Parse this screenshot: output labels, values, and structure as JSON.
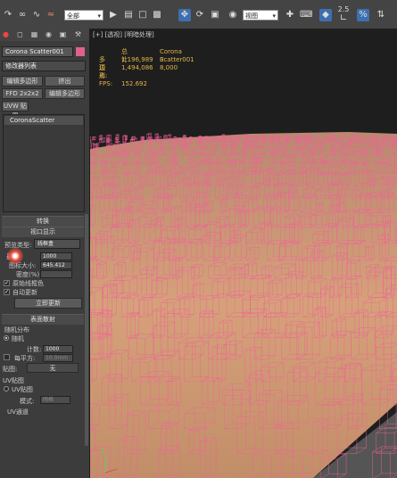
{
  "toolbar": {
    "filter_value": "全部",
    "view_value": "视图",
    "snap_label": "2.5",
    "icons": [
      "arrow-icon",
      "link-icon",
      "unlink-icon",
      "bind-space-warp-icon",
      "select-object-icon",
      "select-by-name-icon",
      "rect-region-icon",
      "window-crossing-icon",
      "move-icon",
      "rotate-icon",
      "scale-icon",
      "pivot-icon",
      "select-manipulate-icon",
      "snap-icon",
      "angle-snap-icon",
      "percent-snap-icon"
    ]
  },
  "command_panel": {
    "tabs": [
      "create-icon",
      "modify-icon",
      "hierarchy-icon",
      "motion-icon",
      "display-icon",
      "utilities-icon"
    ],
    "object_name": "Corona Scatter001",
    "modifier_list": "修改器列表",
    "btn_edit_poly": "编辑多边形",
    "btn_extrude": "挤出",
    "btn_ffd": "FFD 2x2x2",
    "btn_edit_patch": "编辑多边形",
    "btn_uvw": "UVW 贴图",
    "stack_item": "CoronaScatter"
  },
  "rollouts": {
    "transform_header": "转换",
    "viewport_header": "视口显示",
    "preview_type_label": "预览类型:",
    "preview_type_value": "线框盒",
    "max_label": "最大",
    "max_value": "1000",
    "instances_label": "图标大小:",
    "instances_value": "645.412",
    "density_label": "密度(%):",
    "density_value": "",
    "orig_color_label": "原始线框色",
    "auto_update_label": "自动更新",
    "update_button": "立即更新",
    "surface_header": "表面散射",
    "random_dist_label": "随机分布",
    "random_radio": "随机",
    "count_label": "计数:",
    "count_value": "1000",
    "per_area_label": "每平方:",
    "per_area_value": "10.0mm",
    "map_label": "贴图:",
    "map_value": "无",
    "uv_header": "UV贴图",
    "uv_radio": "UV贴图",
    "mode_label": "模式:",
    "mode_value": "网格",
    "uv_channel_label": "UV通道"
  },
  "viewport": {
    "label": "[+] [透视] [明暗处理]",
    "stats": [
      {
        "key": "",
        "a": "总计",
        "b": "Corona Scatter001"
      },
      {
        "key": "多边形:",
        "a": "1,196,989",
        "b": "0"
      },
      {
        "key": "顶点:",
        "a": "1,494,086",
        "b": "8,000"
      }
    ],
    "fps_label": "FPS:",
    "fps_value": "152.692",
    "wire_color": "#f2609a"
  }
}
